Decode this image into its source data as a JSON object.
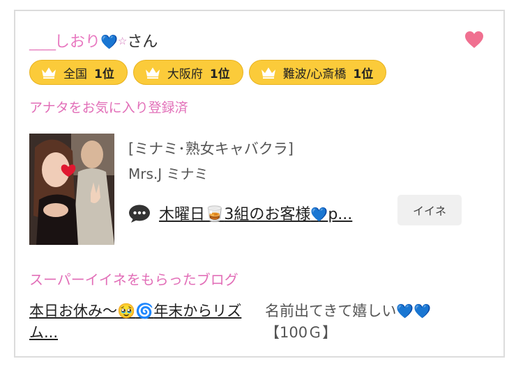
{
  "user": {
    "name_underline": "____",
    "name_text": "しおり",
    "name_heart": "💙",
    "name_star": "☆",
    "name_suffix": "さん",
    "heart_icon": "heart-icon",
    "heart_color": "#f07090"
  },
  "rankings": [
    {
      "area": "全国",
      "rank": "1位"
    },
    {
      "area": "大阪府",
      "rank": "1位"
    },
    {
      "area": "難波/心斎橋",
      "rank": "1位"
    }
  ],
  "favorite_status": "アナタをお気に入り登録済",
  "cast": {
    "shop": "[ミナミ･熟女キャバクラ]",
    "name": "Mrs.J ミナミ"
  },
  "post": {
    "title_a": "木曜日",
    "title_glass": "🥃",
    "title_b": "3組のお客様",
    "title_heart": "💙",
    "title_c": "p...",
    "like_label": "イイネ"
  },
  "super": {
    "heading": "スーパーイイネをもらったブログ",
    "blog_a": "本日お休み〜",
    "blog_emoji1": "🥹",
    "blog_emoji2": "🌀",
    "blog_b": "年末からリズム...",
    "comment_text": "名前出てきて嬉しい",
    "comment_hearts": "💙💙",
    "comment_points": "【100Ｇ】"
  },
  "colors": {
    "accent_pink": "#e26fb8",
    "badge_gold": "#fbcb3a",
    "heart_blue": "#2f6fe0"
  }
}
